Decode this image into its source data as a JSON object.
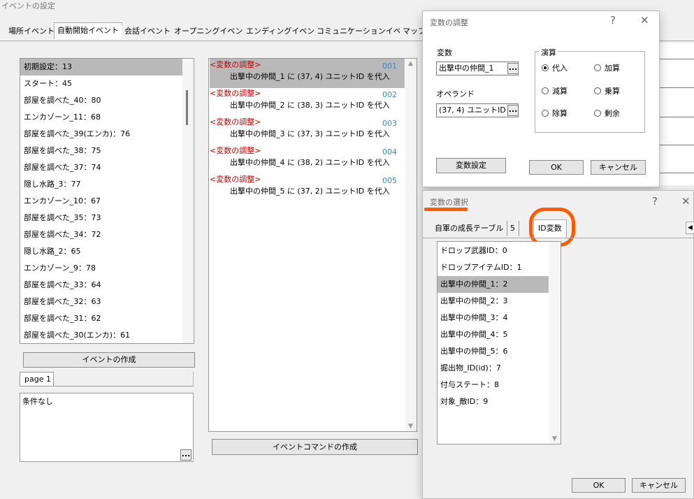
{
  "window": {
    "title": "イベントの設定"
  },
  "tabs": [
    "場所イベント",
    "自動開始イベント",
    "会話イベント",
    "オープニングイベント",
    "エンディングイベント",
    "コミュニケーションイベント",
    "マップ"
  ],
  "event_list": [
    {
      "label": "初期設定：13"
    },
    {
      "label": "スタート：45"
    },
    {
      "label": "部屋を調べた_40：80"
    },
    {
      "label": "エンカゾーン_11：68"
    },
    {
      "label": "部屋を調べた_39(エンカ)：76"
    },
    {
      "label": "部屋を調べた_38：75"
    },
    {
      "label": "部屋を調べた_37：74"
    },
    {
      "label": "隠し水路_3：77"
    },
    {
      "label": "エンカゾーン_10：67"
    },
    {
      "label": "部屋を調べた_35：73"
    },
    {
      "label": "部屋を調べた_34：72"
    },
    {
      "label": "隠し水路_2：65"
    },
    {
      "label": "エンカゾーン_9：78"
    },
    {
      "label": "部屋を調べた_33：64"
    },
    {
      "label": "部屋を調べた_32：63"
    },
    {
      "label": "部屋を調べた_31：62"
    },
    {
      "label": "部屋を調べた_30(エンカ)：61"
    }
  ],
  "create_event_button": "イベントの作成",
  "page_tab": "page 1",
  "condition_text": "条件なし",
  "ellipsis": "...",
  "commands": [
    {
      "header": "<変数の調整>",
      "num": "001",
      "text": "出撃中の仲間_1 に (37, 4) ユニットID を代入"
    },
    {
      "header": "<変数の調整>",
      "num": "002",
      "text": "出撃中の仲間_2 に (38, 3) ユニットID を代入"
    },
    {
      "header": "<変数の調整>",
      "num": "003",
      "text": "出撃中の仲間_3 に (37, 3) ユニットID を代入"
    },
    {
      "header": "<変数の調整>",
      "num": "004",
      "text": "出撃中の仲間_4 に (38, 2) ユニットID を代入"
    },
    {
      "header": "<変数の調整>",
      "num": "005",
      "text": "出撃中の仲間_5 に (37, 2) ユニットID を代入"
    }
  ],
  "create_command_button": "イベントコマンドの作成",
  "var_dialog": {
    "title": "変数の調整",
    "help": "?",
    "close": "✕",
    "variable_label": "変数",
    "variable_value": "出撃中の仲間_1",
    "operand_label": "オペランド",
    "operand_value": "(37, 4) ユニットID",
    "op_group_label": "演算",
    "ops": [
      {
        "label": "代入"
      },
      {
        "label": "加算"
      },
      {
        "label": "減算"
      },
      {
        "label": "乗算"
      },
      {
        "label": "除算"
      },
      {
        "label": "剰余"
      }
    ],
    "selected_op": "代入",
    "set_button": "変数設定",
    "ok": "OK",
    "cancel": "キャンセル"
  },
  "select_dialog": {
    "title": "変数の選択",
    "help": "?",
    "close": "✕",
    "tabs": [
      "自軍の成長テーブル",
      "5",
      "ID変数"
    ],
    "items": [
      {
        "label": "ドロップ武器ID：0"
      },
      {
        "label": "ドロップアイテムID：1"
      },
      {
        "label": "出撃中の仲間_1：2"
      },
      {
        "label": "出撃中の仲間_2：3"
      },
      {
        "label": "出撃中の仲間_3：4"
      },
      {
        "label": "出撃中の仲間_4：5"
      },
      {
        "label": "出撃中の仲間_5：6"
      },
      {
        "label": "掘出物_ID(id)：7"
      },
      {
        "label": "付与ステート：8"
      },
      {
        "label": "対象_敵ID：9"
      }
    ],
    "ok": "OK",
    "cancel": "キャンセル",
    "annotation_color": "#ff5a00"
  }
}
